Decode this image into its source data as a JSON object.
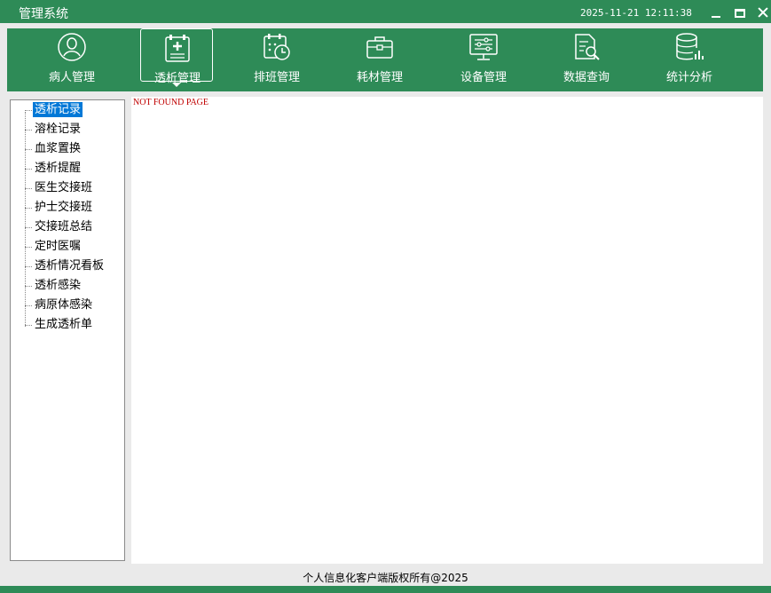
{
  "window": {
    "title": "管理系统",
    "datetime": "2025-11-21 12:11:38",
    "controls": [
      "minimize-icon",
      "maximize-icon",
      "close-icon"
    ]
  },
  "nav": {
    "items": [
      {
        "label": "病人管理",
        "icon": "patient-icon"
      },
      {
        "label": "透析管理",
        "icon": "medical-clipboard-icon",
        "active": true
      },
      {
        "label": "排班管理",
        "icon": "calendar-clock-icon"
      },
      {
        "label": "耗材管理",
        "icon": "briefcase-icon"
      },
      {
        "label": "设备管理",
        "icon": "monitor-sliders-icon"
      },
      {
        "label": "数据查询",
        "icon": "document-search-icon"
      },
      {
        "label": "统计分析",
        "icon": "database-chart-icon"
      }
    ]
  },
  "sidebar": {
    "items": [
      {
        "label": "透析记录",
        "selected": true
      },
      {
        "label": "溶栓记录"
      },
      {
        "label": "血浆置换"
      },
      {
        "label": "透析提醒"
      },
      {
        "label": "医生交接班"
      },
      {
        "label": "护士交接班"
      },
      {
        "label": "交接班总结"
      },
      {
        "label": "定时医嘱"
      },
      {
        "label": "透析情况看板"
      },
      {
        "label": "透析感染"
      },
      {
        "label": "病原体感染"
      },
      {
        "label": "生成透析单"
      }
    ]
  },
  "content": {
    "message": "NOT FOUND PAGE"
  },
  "footer": {
    "text": "个人信息化客户端版权所有@2025"
  },
  "colors": {
    "brand_green": "#2e8b57",
    "selection_blue": "#0078d7",
    "error_red": "#c00000"
  }
}
